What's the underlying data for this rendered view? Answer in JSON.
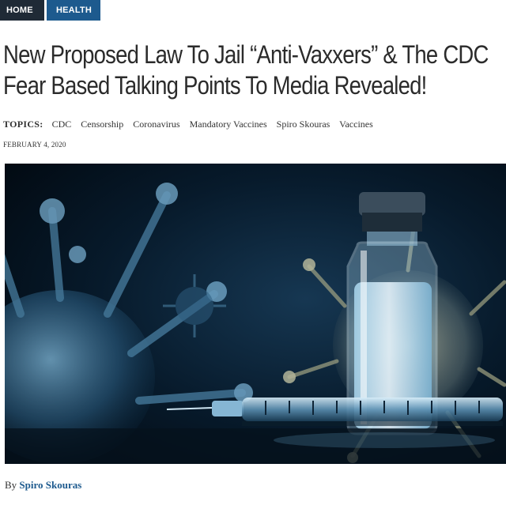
{
  "breadcrumbs": [
    {
      "label": "HOME"
    },
    {
      "label": "HEALTH"
    }
  ],
  "article": {
    "title_line1": "New Proposed Law To Jail “Anti-Vaxxers” & The CDC",
    "title_line2": "Fear Based Talking Points To Media Revealed!",
    "topics_label": "TOPICS:",
    "topics": [
      "CDC",
      "Censorship",
      "Coronavirus",
      "Mandatory Vaccines",
      "Spiro Skouras",
      "Vaccines"
    ],
    "date": "FEBRUARY 4, 2020",
    "byline_prefix": "By",
    "author": "Spiro Skouras"
  },
  "hero_image": {
    "subject": "vaccine vial and syringe with virus particles",
    "colors": {
      "background": "#04101c",
      "glow": "#6fb0d6",
      "liquid": "#c9e6f4"
    }
  }
}
